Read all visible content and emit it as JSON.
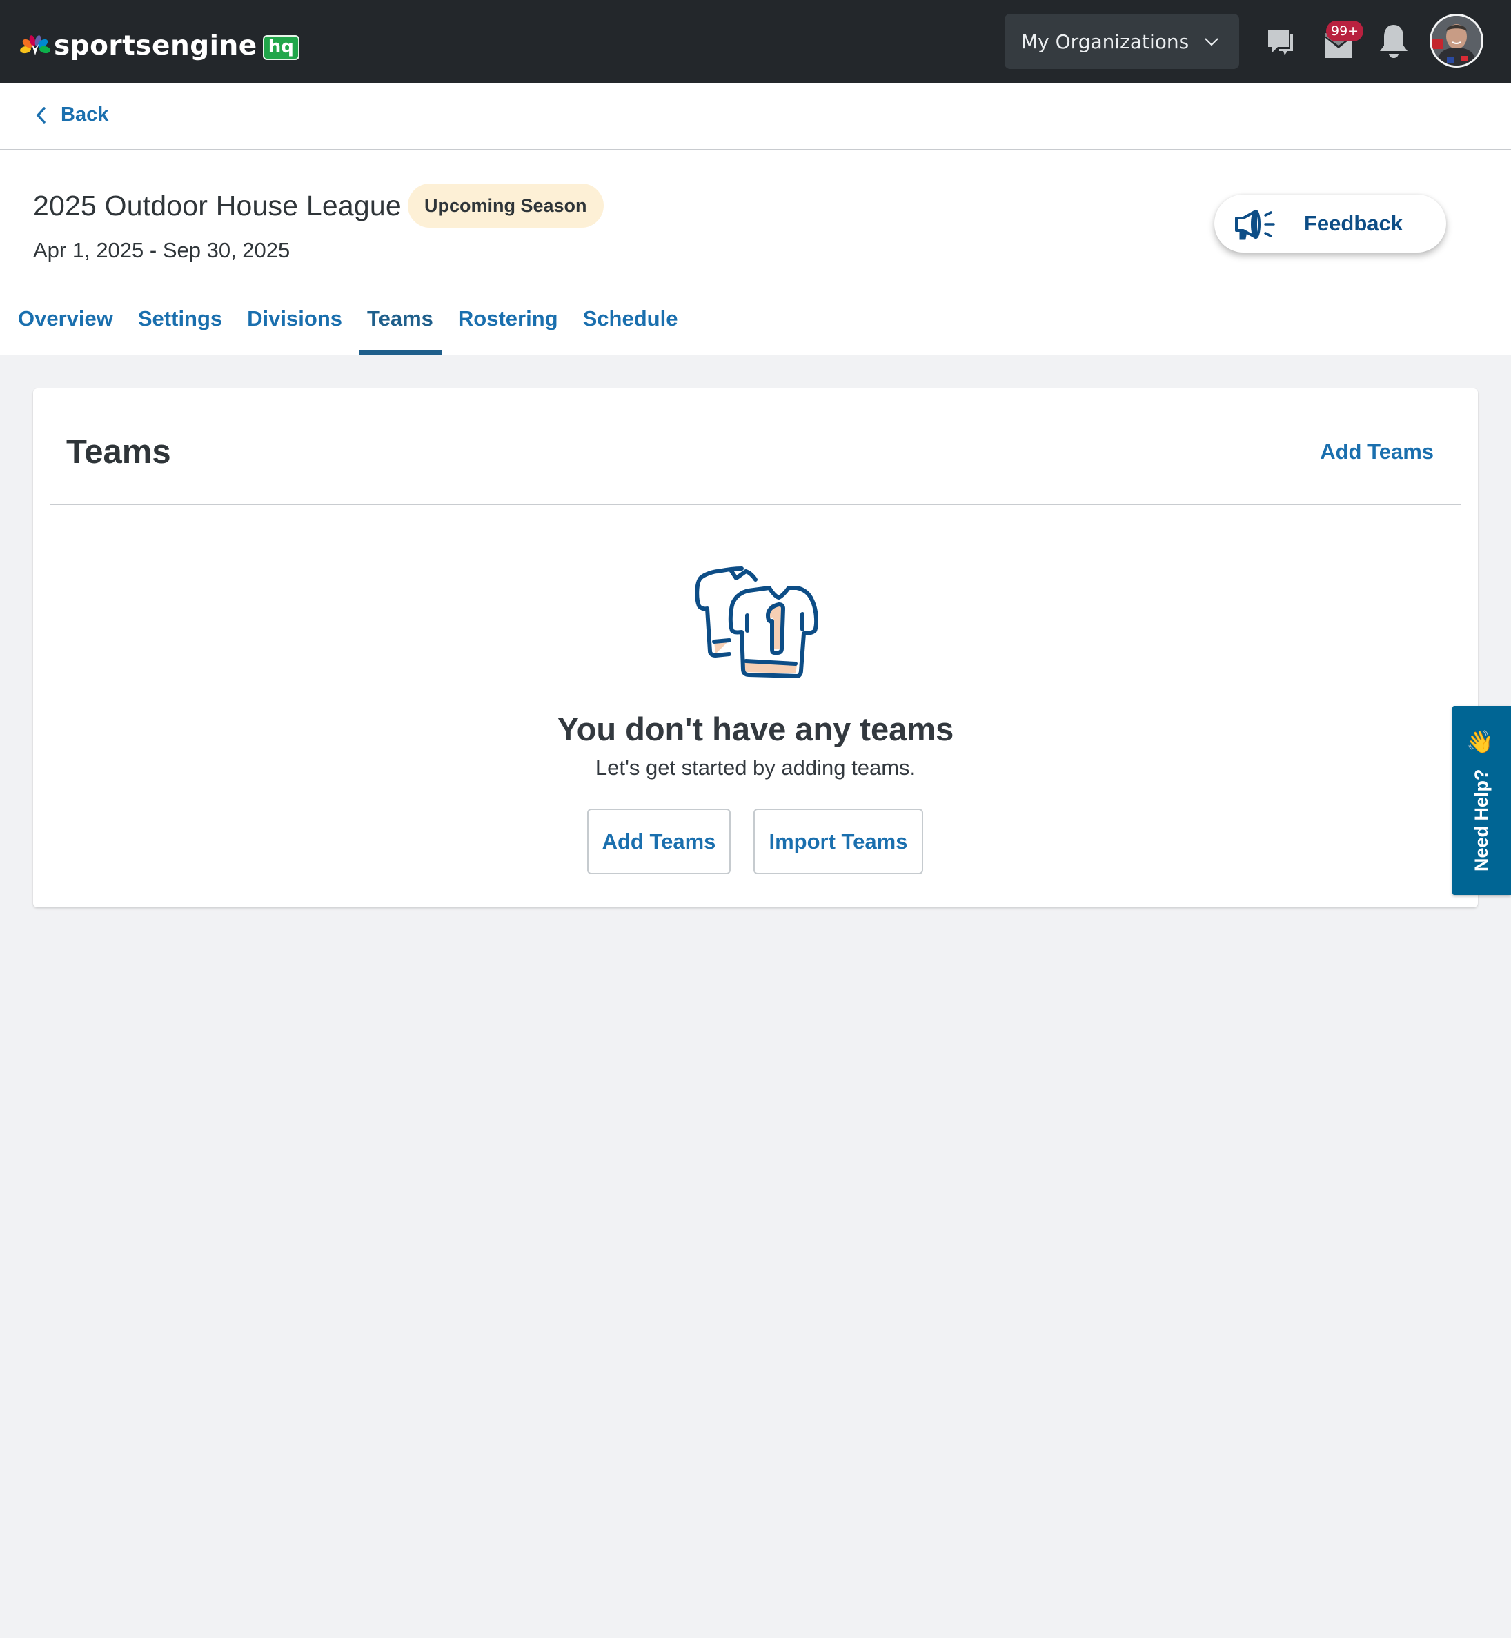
{
  "topnav": {
    "logo_text": "sportsengine",
    "logo_badge": "hq",
    "org_menu_label": "My Organizations",
    "mail_badge": "99+",
    "icons": [
      "chat-icon",
      "mail-icon",
      "bell-icon",
      "avatar"
    ]
  },
  "back": {
    "label": "Back"
  },
  "header": {
    "title": "2025 Outdoor House League",
    "status": "Upcoming Season",
    "dates": "Apr 1, 2025 - Sep 30, 2025",
    "feedback_label": "Feedback"
  },
  "tabs": [
    {
      "label": "Overview",
      "active": false
    },
    {
      "label": "Settings",
      "active": false
    },
    {
      "label": "Divisions",
      "active": false
    },
    {
      "label": "Teams",
      "active": true
    },
    {
      "label": "Rostering",
      "active": false
    },
    {
      "label": "Schedule",
      "active": false
    }
  ],
  "card": {
    "title": "Teams",
    "add_link": "Add Teams",
    "empty": {
      "heading": "You don't have any teams",
      "subtext": "Let's get started by adding teams.",
      "add_button": "Add Teams",
      "import_button": "Import Teams"
    }
  },
  "need_help": {
    "label": "Need Help?",
    "emoji": "👋"
  },
  "colors": {
    "nav_bg": "#23272b",
    "link_blue": "#1a6fae",
    "active_tab": "#1f5f8b",
    "badge_red": "#b8213f",
    "status_pill_bg": "#fdf0d6",
    "help_tab": "#006594",
    "logo_green": "#21a64a",
    "page_bg": "#f1f2f4"
  }
}
